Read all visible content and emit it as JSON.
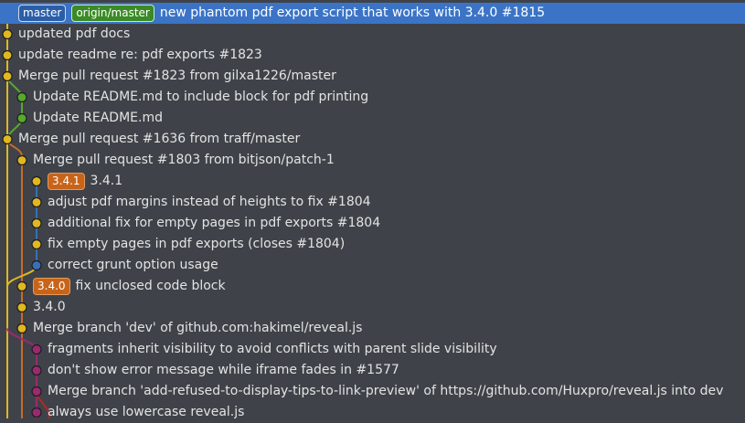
{
  "colors": {
    "background": "#3f4349",
    "selected": "#3b74c6",
    "lane_yellow": "#e0b820",
    "lane_green": "#57a82c",
    "lane_blue": "#3a6fb8",
    "lane_orange": "#c86a28",
    "lane_purple": "#9a2a70",
    "lane_red": "#b02828"
  },
  "commits": [
    {
      "refs": [
        {
          "kind": "branch",
          "label": "master"
        },
        {
          "kind": "remote",
          "label": "origin/master"
        }
      ],
      "message": "new phantom pdf export script that works with 3.4.0 #1815",
      "selected": true
    },
    {
      "refs": [],
      "message": "updated pdf docs"
    },
    {
      "refs": [],
      "message": "update readme re: pdf exports #1823"
    },
    {
      "refs": [],
      "message": "Merge pull request #1823 from gilxa1226/master"
    },
    {
      "refs": [],
      "message": "Update README.md to include block for pdf printing"
    },
    {
      "refs": [],
      "message": "Update README.md"
    },
    {
      "refs": [],
      "message": "Merge pull request #1636 from traff/master"
    },
    {
      "refs": [],
      "message": "Merge pull request #1803 from bitjson/patch-1"
    },
    {
      "refs": [
        {
          "kind": "version",
          "label": "3.4.1"
        }
      ],
      "message": "3.4.1"
    },
    {
      "refs": [],
      "message": "adjust pdf margins instead of heights to fix #1804"
    },
    {
      "refs": [],
      "message": "additional fix for empty pages in pdf exports #1804"
    },
    {
      "refs": [],
      "message": "fix empty pages in pdf exports (closes #1804)"
    },
    {
      "refs": [],
      "message": "correct grunt option usage"
    },
    {
      "refs": [
        {
          "kind": "version",
          "label": "3.4.0"
        }
      ],
      "message": "fix unclosed code block"
    },
    {
      "refs": [],
      "message": "3.4.0"
    },
    {
      "refs": [],
      "message": "Merge branch 'dev' of github.com:hakimel/reveal.js"
    },
    {
      "refs": [],
      "message": "fragments inherit visibility to avoid conflicts with parent slide visibility"
    },
    {
      "refs": [],
      "message": "don't show error message while iframe fades in #1577"
    },
    {
      "refs": [],
      "message": "Merge branch 'add-refused-to-display-tips-to-link-preview' of https://github.com/Huxpro/reveal.js into dev"
    },
    {
      "refs": [],
      "message": "always use lowercase reveal.js"
    }
  ]
}
